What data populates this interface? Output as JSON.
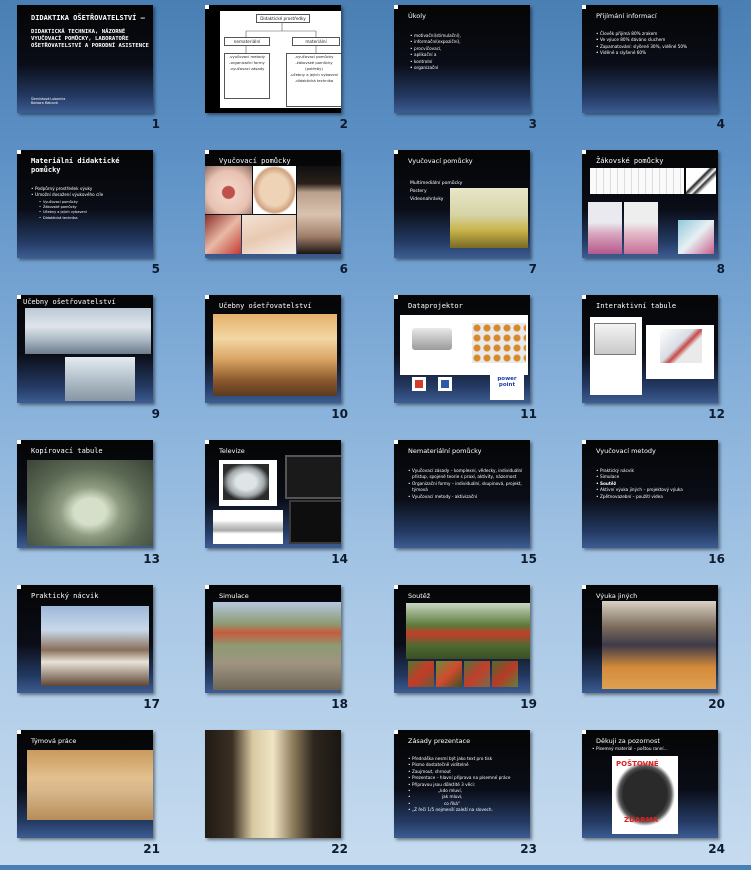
{
  "slides": [
    {
      "num": "1",
      "title": "DIDAKTIKA OŠETŘOVATELSTVÍ –",
      "subtitle": "DIDAKTICKÁ TECHNIKA, NÁZORNÉ VYUČOVACÍ POMŮCKY, LABORATOŘE OŠETŘOVATELSTVÍ A PORODNÍ ASISTENCE",
      "authors": "Šlemínková Lubomíra\nBarbora Malcová"
    },
    {
      "num": "2",
      "diagram": {
        "root": "Didaktické prostředky",
        "left": "nemateriální",
        "right": "materiální",
        "left_items": "-vyučovací metody\n-organizační formy\n-vyučovací zásady",
        "right_items": "-vyučovací pomůcky\n-žákovské pomůcky (potřeby)\n-učebny a jejich vybavení\n-didaktická technika"
      }
    },
    {
      "num": "3",
      "title": "Úkoly",
      "items": [
        "motivační(stimulační),",
        "informační(expoziční),",
        "procvičovací,",
        "aplikační a",
        "kontrolní",
        "",
        "organizační"
      ]
    },
    {
      "num": "4",
      "title": "Přijímání informací",
      "items": [
        "Člověk přijímá 80% zrakem",
        "",
        "Ve výuce 80% dáváno sluchem",
        "",
        "Zapamatování: slyšené 30%, viděné 50%",
        "",
        "Viděné a slyšené 60%"
      ]
    },
    {
      "num": "5",
      "title": "Materiální didaktické pomůcky",
      "items": [
        "Podpůrný prostředek výuky",
        "Umožní dosažení výukového cíle"
      ],
      "sub_items": [
        "Vyučovací pomůcky",
        "Žákovské pomůcky",
        "Učebny a jejich vybavení",
        "Didaktická technika"
      ]
    },
    {
      "num": "6",
      "title": "Vyučovací pomůcky"
    },
    {
      "num": "7",
      "title": "Vyučovací pomůcky",
      "lines": [
        "Multimediální pomůcky",
        "Postery",
        "Videonahrávky"
      ]
    },
    {
      "num": "8",
      "title": "Žákovské pomůcky"
    },
    {
      "num": "9",
      "title": "Učebny ošetřovatelství"
    },
    {
      "num": "10",
      "title": "Učebny ošetřovatelství"
    },
    {
      "num": "11",
      "title": "Dataprojektor",
      "logo": "power point"
    },
    {
      "num": "12",
      "title": "Interaktivní tabule"
    },
    {
      "num": "13",
      "title": "Kopírovací tabule"
    },
    {
      "num": "14",
      "title": "Televize"
    },
    {
      "num": "15",
      "title": "Nemateriální pomůcky",
      "items": [
        "Vyučovací zásady – komplexní, vědecky, individuální přístup, spojené teorie s praxí, aktivity, názornost",
        "Organizační formy – individuální, skupinová, projekt, týmová",
        "Vyučovací metody - aktivizační"
      ]
    },
    {
      "num": "16",
      "title": "Vyučovací metody",
      "items": [
        "Praktický nácvik",
        "Simulace",
        "Soutěž",
        "Aktivní výuka jiných – projektový výuka",
        "Zpětnovazební – použití videa"
      ]
    },
    {
      "num": "17",
      "title": "Praktický nácvik"
    },
    {
      "num": "18",
      "title": "Simulace"
    },
    {
      "num": "19",
      "title": "Soutěž"
    },
    {
      "num": "20",
      "title": "Výuka jiných"
    },
    {
      "num": "21",
      "title": "Týmová práce"
    },
    {
      "num": "22"
    },
    {
      "num": "23",
      "title": "Zásady prezentace",
      "items": [
        "Přednáška nesmí být jako text pro tisk",
        "Písmo dostatečně viditelné",
        "Zaujmout, shrnout",
        "Prezentace – hlavní příprava na písemné práce",
        "Přípravou jsou důležité 3 věci:"
      ],
      "quotes": [
        "„kdo mluví,",
        "jak mluví,",
        "co říká“",
        "„Z řeči 1/5 nejmenší zaleží na slovech."
      ]
    },
    {
      "num": "24",
      "title": "Děkuji za pozornost",
      "items": [
        "Písemný materiál – poštou ranní..."
      ],
      "stamp_top": "POŠTOVNÉ",
      "stamp_bottom": "ZDARMA"
    }
  ]
}
